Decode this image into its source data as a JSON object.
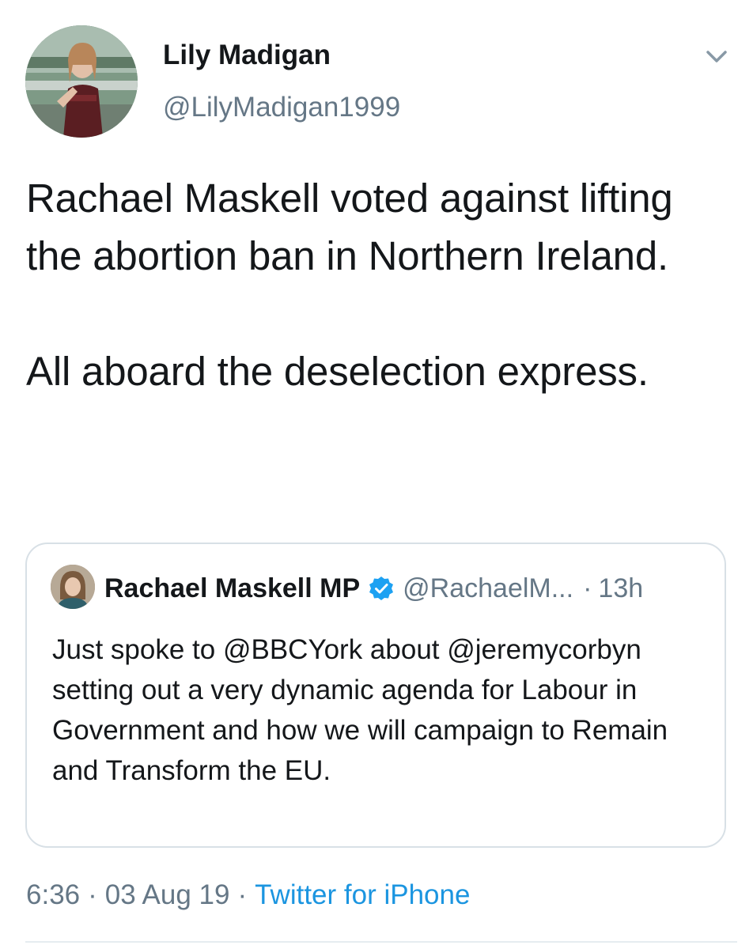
{
  "author": {
    "display_name": "Lily Madigan",
    "handle": "@LilyMadigan1999"
  },
  "tweet": {
    "text": "Rachael Maskell voted against lifting the abortion ban in Northern Ireland.\n\nAll aboard the deselection express."
  },
  "quoted_tweet": {
    "display_name": "Rachael Maskell MP",
    "handle": "@RachaelM...",
    "separator": "·",
    "time": "13h",
    "text": "Just spoke to @BBCYork about @jeremycorbyn setting out a very dynamic agenda for Labour in Government and how we will campaign to Remain and Transform the EU."
  },
  "meta": {
    "time": "6:36",
    "separator": "·",
    "date": "03 Aug 19",
    "source": "Twitter for iPhone"
  },
  "icons": {
    "caret": "chevron-down-icon",
    "verified": "verified-badge-icon"
  },
  "colors": {
    "text_primary": "#14171a",
    "text_secondary": "#657786",
    "link": "#1b95e0",
    "verified": "#1da1f2",
    "border": "#d8e0e6"
  }
}
